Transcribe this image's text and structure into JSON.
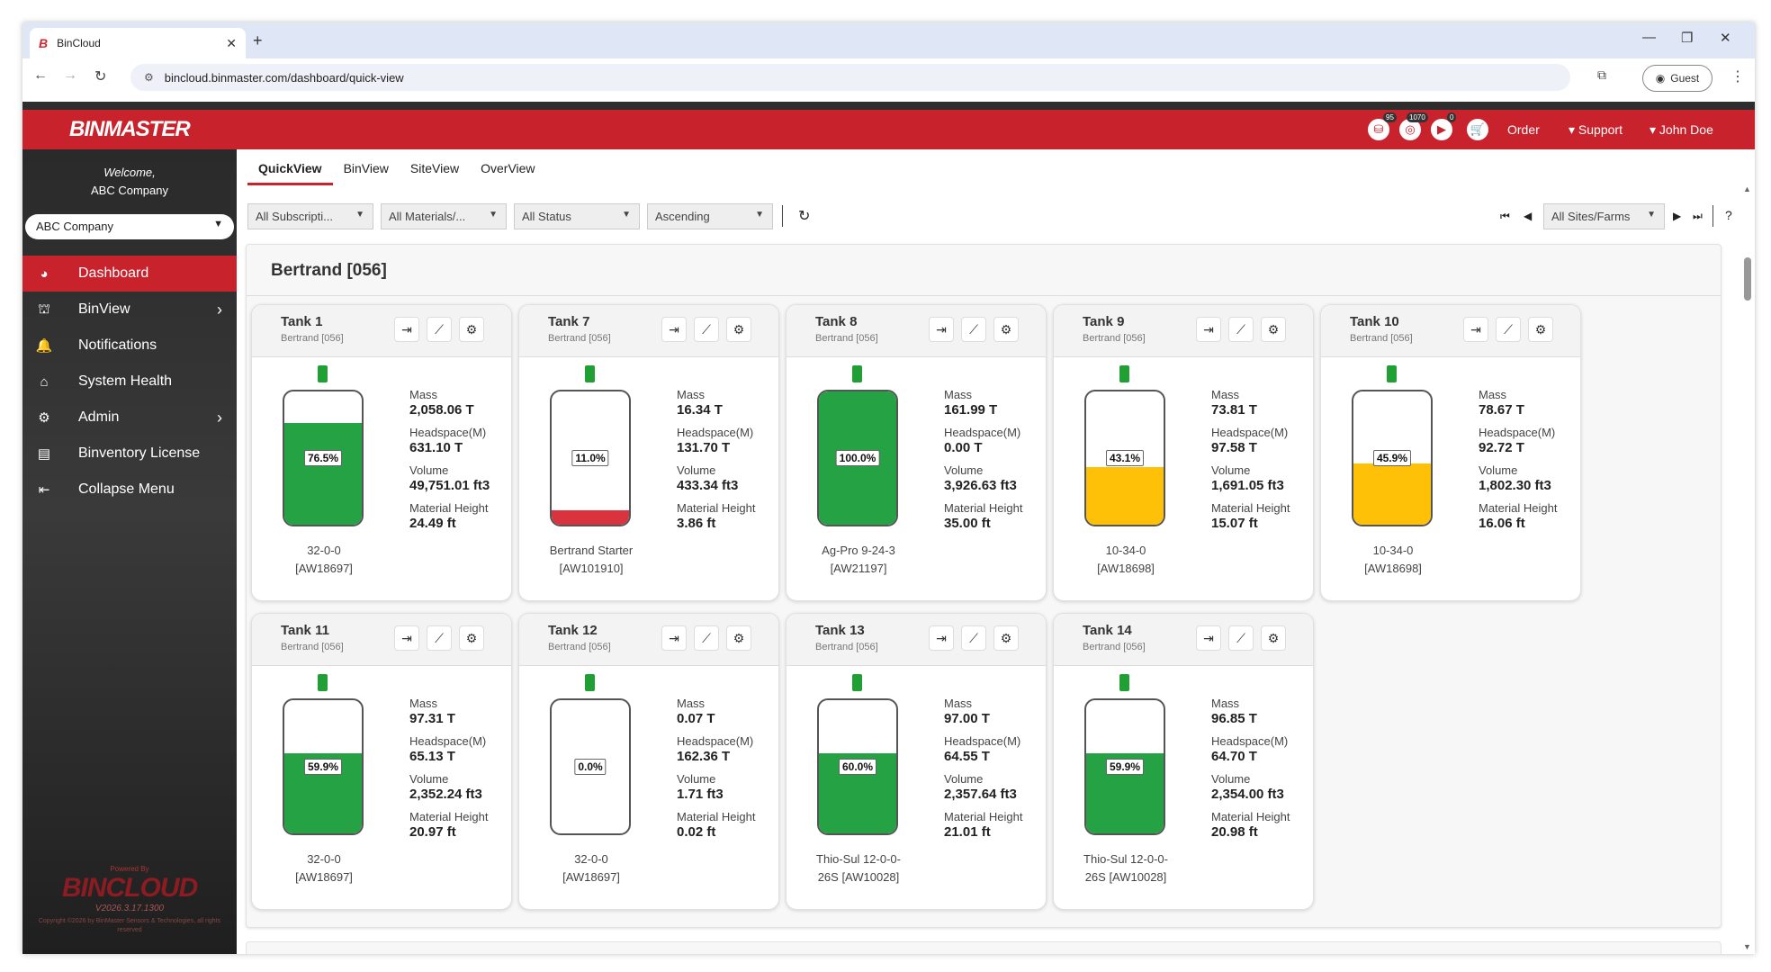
{
  "browser": {
    "tab_title": "BinCloud",
    "tab_favicon": "B",
    "new_tab": "+",
    "url": "bincloud.binmaster.com/dashboard/quick-view",
    "profile_label": "Guest"
  },
  "header": {
    "logo": "BINMASTER",
    "badges": [
      "95",
      "1070",
      "0"
    ],
    "order": "Order",
    "support": "Support",
    "user": "John Doe"
  },
  "sidebar": {
    "welcome": "Welcome,",
    "company_name": "ABC Company",
    "company_select": "ABC Company",
    "items": [
      {
        "label": "Dashboard",
        "icon": "dashboard-icon"
      },
      {
        "label": "BinView",
        "icon": "silo-icon"
      },
      {
        "label": "Notifications",
        "icon": "bell-icon"
      },
      {
        "label": "System Health",
        "icon": "router-icon"
      },
      {
        "label": "Admin",
        "icon": "gears-icon"
      },
      {
        "label": "Binventory License",
        "icon": "license-icon"
      },
      {
        "label": "Collapse Menu",
        "icon": "collapse-icon"
      }
    ],
    "powered_by": "Powered By",
    "brand": "BINCLOUD",
    "version": "V2026.3.17.1300",
    "copyright": "Copyright ©2026 by BinMaster Sensors & Technologies, all rights reserved"
  },
  "view_tabs": [
    "QuickView",
    "BinView",
    "SiteView",
    "OverView"
  ],
  "filters": {
    "subscriptions": "All Subscripti...",
    "materials": "All Materials/...",
    "status": "All Status",
    "sort": "Ascending",
    "sites": "All Sites/Farms",
    "help": "?"
  },
  "site_group": {
    "title": "Bertrand [056]",
    "labels": {
      "mass": "Mass",
      "headspace": "Headspace(M)",
      "volume": "Volume",
      "height": "Material Height"
    },
    "tanks": [
      {
        "name": "Tank 1",
        "site": "Bertrand [056]",
        "level": 76.5,
        "pct": "76.5%",
        "fill_color": "#25a244",
        "mass": "2,058.06 T",
        "headspace": "631.10 T",
        "volume": "49,751.01 ft3",
        "height": "24.49 ft",
        "material_line1": "32-0-0",
        "material_line2": "[AW18697]"
      },
      {
        "name": "Tank 7",
        "site": "Bertrand [056]",
        "level": 11.0,
        "pct": "11.0%",
        "fill_color": "#d9333f",
        "mass": "16.34 T",
        "headspace": "131.70 T",
        "volume": "433.34 ft3",
        "height": "3.86 ft",
        "material_line1": "Bertrand Starter",
        "material_line2": "[AW101910]"
      },
      {
        "name": "Tank 8",
        "site": "Bertrand [056]",
        "level": 100.0,
        "pct": "100.0%",
        "fill_color": "#25a244",
        "mass": "161.99 T",
        "headspace": "0.00 T",
        "volume": "3,926.63 ft3",
        "height": "35.00 ft",
        "material_line1": "Ag-Pro 9-24-3",
        "material_line2": "[AW21197]"
      },
      {
        "name": "Tank 9",
        "site": "Bertrand [056]",
        "level": 43.1,
        "pct": "43.1%",
        "fill_color": "#ffc107",
        "mass": "73.81 T",
        "headspace": "97.58 T",
        "volume": "1,691.05 ft3",
        "height": "15.07 ft",
        "material_line1": "10-34-0",
        "material_line2": "[AW18698]"
      },
      {
        "name": "Tank 10",
        "site": "Bertrand [056]",
        "level": 45.9,
        "pct": "45.9%",
        "fill_color": "#ffc107",
        "mass": "78.67 T",
        "headspace": "92.72 T",
        "volume": "1,802.30 ft3",
        "height": "16.06 ft",
        "material_line1": "10-34-0",
        "material_line2": "[AW18698]"
      },
      {
        "name": "Tank 11",
        "site": "Bertrand [056]",
        "level": 59.9,
        "pct": "59.9%",
        "fill_color": "#25a244",
        "mass": "97.31 T",
        "headspace": "65.13 T",
        "volume": "2,352.24 ft3",
        "height": "20.97 ft",
        "material_line1": "32-0-0",
        "material_line2": "[AW18697]"
      },
      {
        "name": "Tank 12",
        "site": "Bertrand [056]",
        "level": 0.0,
        "pct": "0.0%",
        "fill_color": "#25a244",
        "mass": "0.07 T",
        "headspace": "162.36 T",
        "volume": "1.71 ft3",
        "height": "0.02 ft",
        "material_line1": "32-0-0",
        "material_line2": "[AW18697]"
      },
      {
        "name": "Tank 13",
        "site": "Bertrand [056]",
        "level": 60.0,
        "pct": "60.0%",
        "fill_color": "#25a244",
        "mass": "97.00 T",
        "headspace": "64.55 T",
        "volume": "2,357.64 ft3",
        "height": "21.01 ft",
        "material_line1": "Thio-Sul 12-0-0-",
        "material_line2": "26S [AW10028]"
      },
      {
        "name": "Tank 14",
        "site": "Bertrand [056]",
        "level": 59.9,
        "pct": "59.9%",
        "fill_color": "#25a244",
        "mass": "96.85 T",
        "headspace": "64.70 T",
        "volume": "2,354.00 ft3",
        "height": "20.98 ft",
        "material_line1": "Thio-Sul 12-0-0-",
        "material_line2": "26S [AW10028]"
      }
    ]
  }
}
